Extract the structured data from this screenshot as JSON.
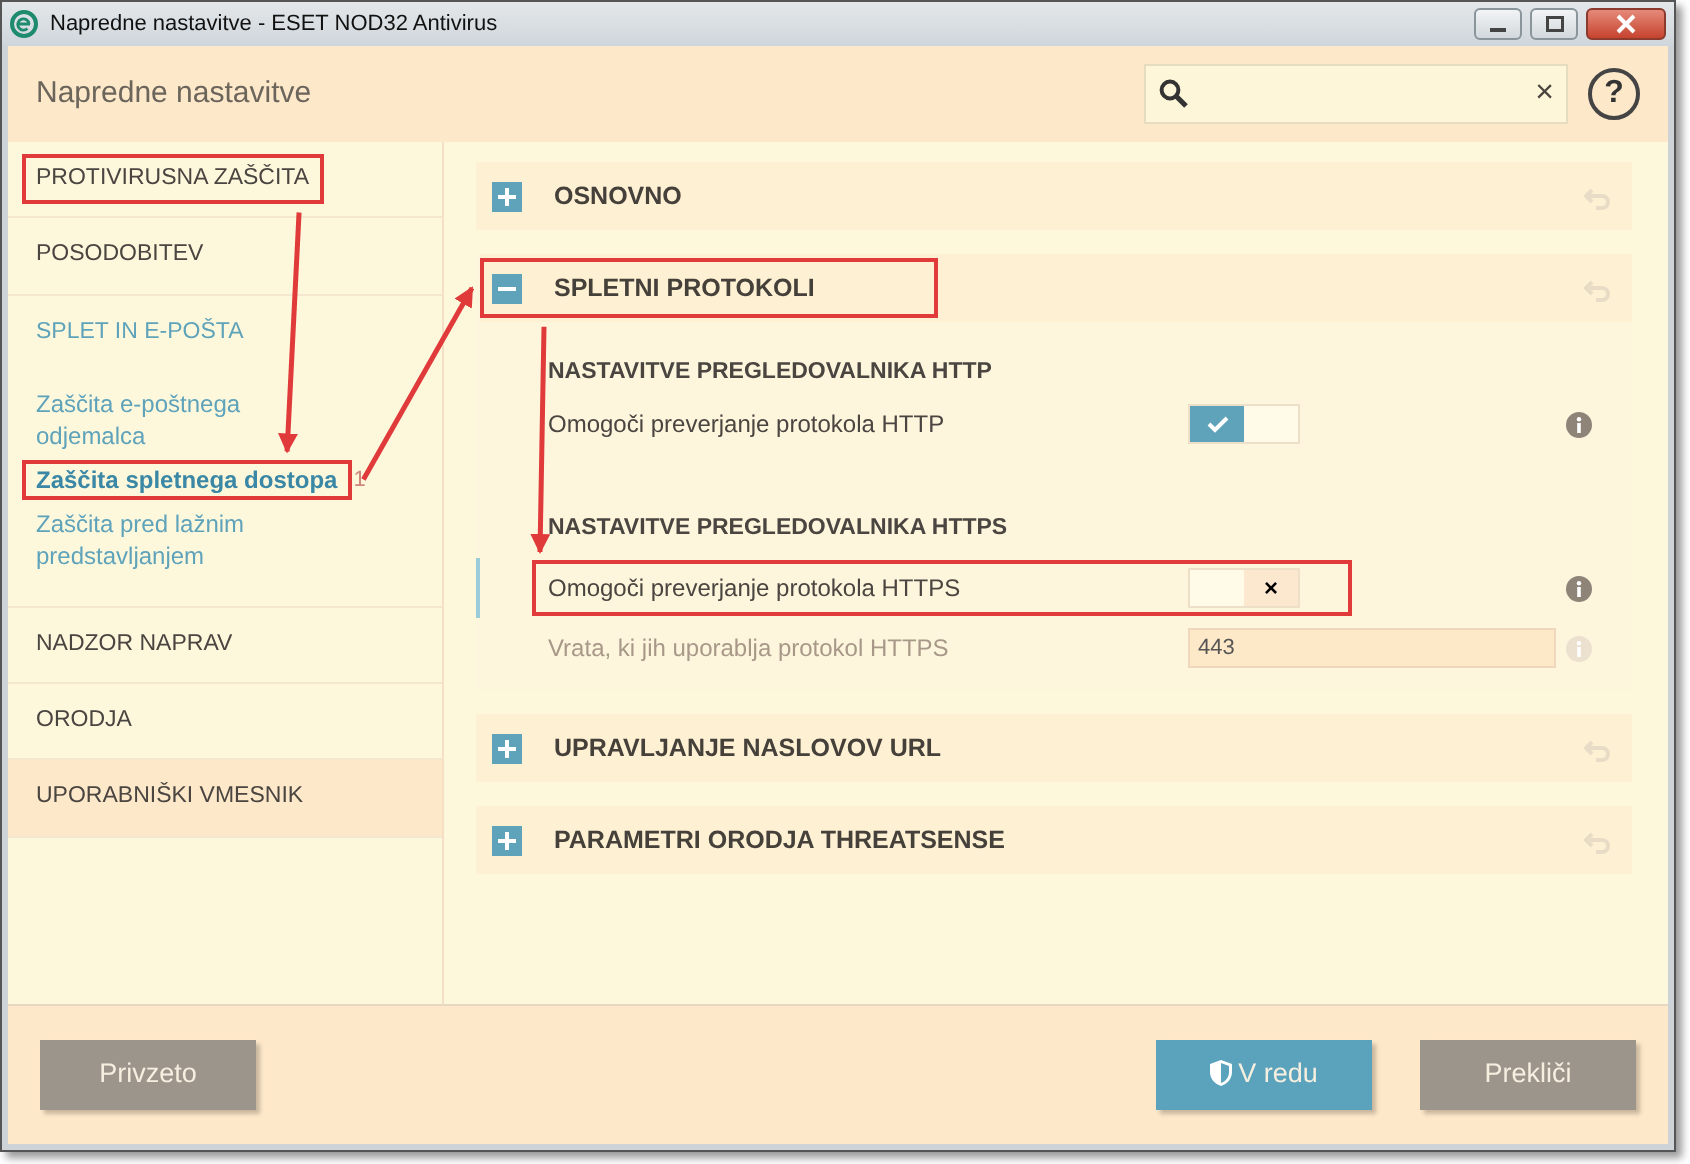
{
  "window": {
    "title": "Napredne nastavitve - ESET NOD32 Antivirus"
  },
  "header": {
    "title": "Napredne nastavitve",
    "search": {
      "clear": "×"
    },
    "help": "?"
  },
  "sidebar": [
    {
      "label": "PROTIVIRUSNA ZAŠČITA",
      "hovered": false,
      "highlighted": true
    },
    {
      "label": "POSODOBITEV",
      "hovered": false,
      "highlighted": false
    },
    {
      "label": "SPLET IN E-POŠTA",
      "hovered": false,
      "highlighted": false,
      "children": [
        {
          "label": "Zaščita e-poštnega odjemalca",
          "selected": false,
          "highlighted": false
        },
        {
          "label": "Zaščita spletnega dostopa",
          "selected": true,
          "highlighted": true,
          "count": "1"
        },
        {
          "label": "Zaščita pred lažnim predstavljanjem",
          "selected": false,
          "highlighted": false
        }
      ]
    },
    {
      "label": "NADZOR NAPRAV",
      "hovered": false,
      "highlighted": false
    },
    {
      "label": "ORODJA",
      "hovered": false,
      "highlighted": false
    },
    {
      "label": "UPORABNIŠKI VMESNIK",
      "hovered": true,
      "highlighted": false
    }
  ],
  "sections": [
    {
      "title": "OSNOVNO",
      "expanded": false,
      "highlighted": false
    },
    {
      "title": "SPLETNI PROTOKOLI",
      "expanded": true,
      "highlighted": true,
      "items": [
        {
          "kind": "heading",
          "label": "NASTAVITVE PREGLEDOVALNIKA HTTP"
        },
        {
          "kind": "toggle",
          "label": "Omogoči preverjanje protokola HTTP",
          "on": true,
          "disabled": false,
          "highlighted": false
        },
        {
          "kind": "heading",
          "label": "NASTAVITVE PREGLEDOVALNIKA HTTPS"
        },
        {
          "kind": "toggle",
          "label": "Omogoči preverjanje protokola HTTPS",
          "on": false,
          "disabled": false,
          "highlighted": true,
          "off_mark": "×"
        },
        {
          "kind": "number",
          "label": "Vrata, ki jih uporablja protokol HTTPS",
          "value": "443",
          "disabled": true,
          "highlighted": false
        }
      ]
    },
    {
      "title": "UPRAVLJANJE NASLOVOV URL",
      "expanded": false,
      "highlighted": false
    },
    {
      "title": "PARAMETRI ORODJA THREATSENSE",
      "expanded": false,
      "highlighted": false
    }
  ],
  "annotation": {
    "arrows_between_highlights": true
  },
  "buttons": [
    {
      "label": "Privzeto",
      "kind": "plain"
    },
    {
      "label": "V redu",
      "kind": "primary"
    },
    {
      "label": "Prekliči",
      "kind": "plain"
    }
  ]
}
